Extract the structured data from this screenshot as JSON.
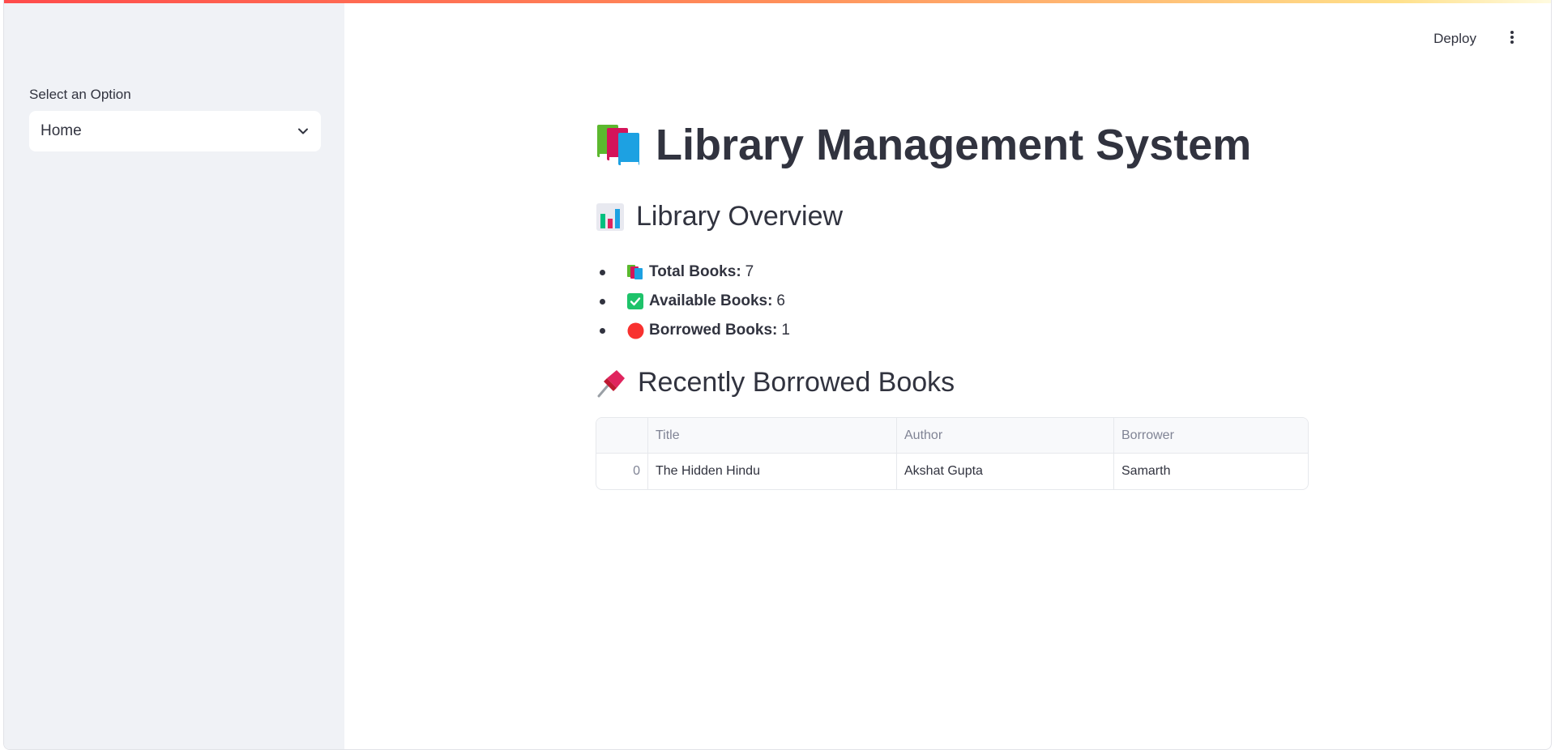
{
  "sidebar": {
    "select_label": "Select an Option",
    "select_value": "Home"
  },
  "header": {
    "deploy_label": "Deploy"
  },
  "main": {
    "title": "Library Management System",
    "overview_heading": "Library Overview",
    "stats": [
      {
        "label": "Total Books:",
        "value": "7",
        "icon": "books-icon"
      },
      {
        "label": "Available Books:",
        "value": "6",
        "icon": "check-mark-icon"
      },
      {
        "label": "Borrowed Books:",
        "value": "1",
        "icon": "red-circle-icon"
      }
    ],
    "recent_heading": "Recently Borrowed Books",
    "table": {
      "columns": [
        "",
        "Title",
        "Author",
        "Borrower"
      ],
      "rows": [
        {
          "index": "0",
          "title": "The Hidden Hindu",
          "author": "Akshat Gupta",
          "borrower": "Samarth"
        }
      ]
    }
  },
  "colors": {
    "accent": "#ff4b4b",
    "sidebar_bg": "#f0f2f6",
    "text": "#31333f",
    "check_green": "#1ec36a",
    "circle_red": "#f8312f"
  }
}
